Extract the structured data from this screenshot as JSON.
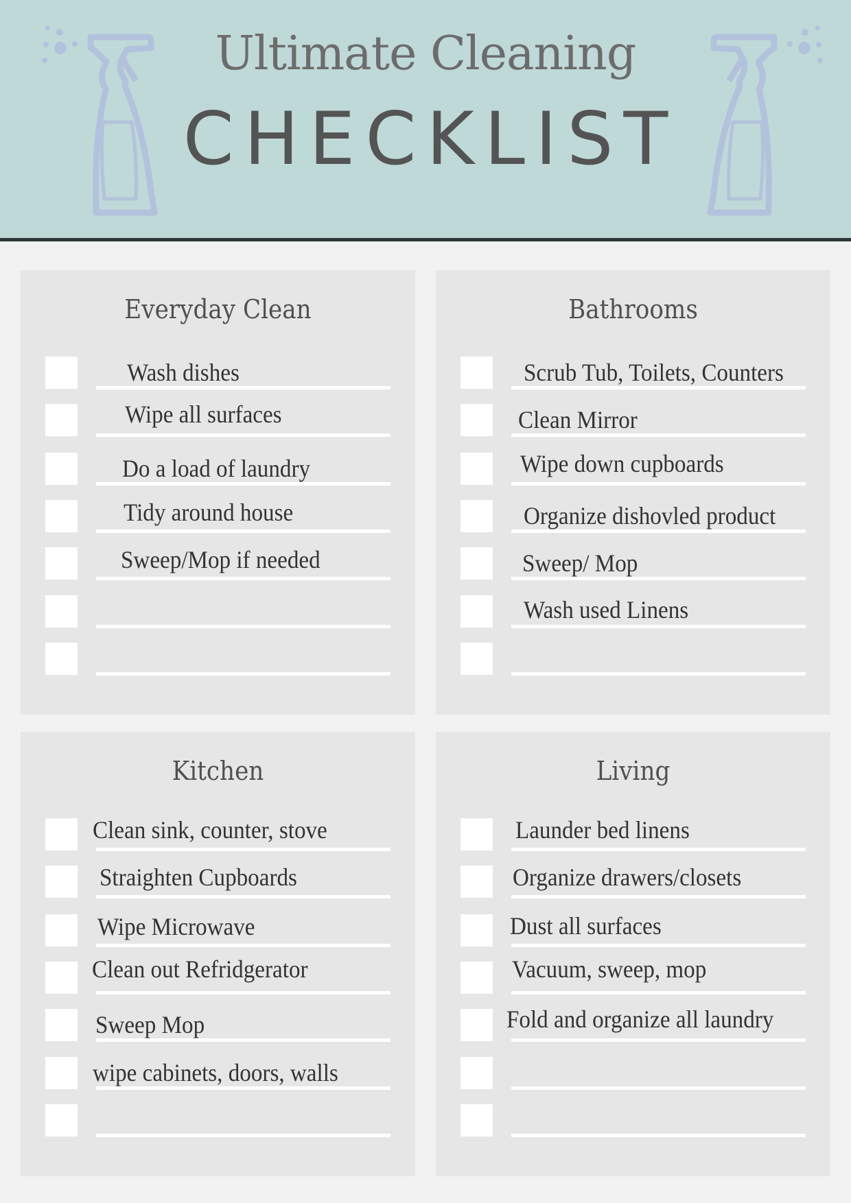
{
  "header": {
    "title_top": "Ultimate Cleaning",
    "title_main": "CHECKLIST",
    "background_color": "#bfd9d8",
    "decoration_icon": "spray-bottle-icon"
  },
  "panels": [
    {
      "title": "Everyday Clean",
      "items": [
        {
          "text": "Wash dishes",
          "checked": false
        },
        {
          "text": "Wipe all surfaces",
          "checked": false
        },
        {
          "text": "Do a load of laundry",
          "checked": false
        },
        {
          "text": "Tidy around house",
          "checked": false
        },
        {
          "text": "Sweep/Mop if needed",
          "checked": false
        },
        {
          "text": "",
          "checked": false
        },
        {
          "text": "",
          "checked": false
        }
      ]
    },
    {
      "title": "Bathrooms",
      "items": [
        {
          "text": "Scrub Tub, Toilets, Counters",
          "checked": false
        },
        {
          "text": "Clean Mirror",
          "checked": false
        },
        {
          "text": "Wipe down cupboards",
          "checked": false
        },
        {
          "text": "Organize dishovled product",
          "checked": false
        },
        {
          "text": "Sweep/ Mop",
          "checked": false
        },
        {
          "text": "Wash used Linens",
          "checked": false
        },
        {
          "text": "",
          "checked": false
        }
      ]
    },
    {
      "title": "Kitchen",
      "items": [
        {
          "text": "Clean sink, counter, stove",
          "checked": false
        },
        {
          "text": "Straighten Cupboards",
          "checked": false
        },
        {
          "text": "Wipe Microwave",
          "checked": false
        },
        {
          "text": "Clean out Refridgerator",
          "checked": false
        },
        {
          "text": "Sweep Mop",
          "checked": false
        },
        {
          "text": "wipe cabinets, doors, walls",
          "checked": false
        },
        {
          "text": "",
          "checked": false
        }
      ]
    },
    {
      "title": "Living",
      "items": [
        {
          "text": "Launder bed linens",
          "checked": false
        },
        {
          "text": "Organize drawers/closets",
          "checked": false
        },
        {
          "text": "Dust all surfaces",
          "checked": false
        },
        {
          "text": "Vacuum, sweep, mop",
          "checked": false
        },
        {
          "text": "Fold and organize all laundry",
          "checked": false
        },
        {
          "text": "",
          "checked": false
        },
        {
          "text": "",
          "checked": false
        }
      ]
    }
  ]
}
